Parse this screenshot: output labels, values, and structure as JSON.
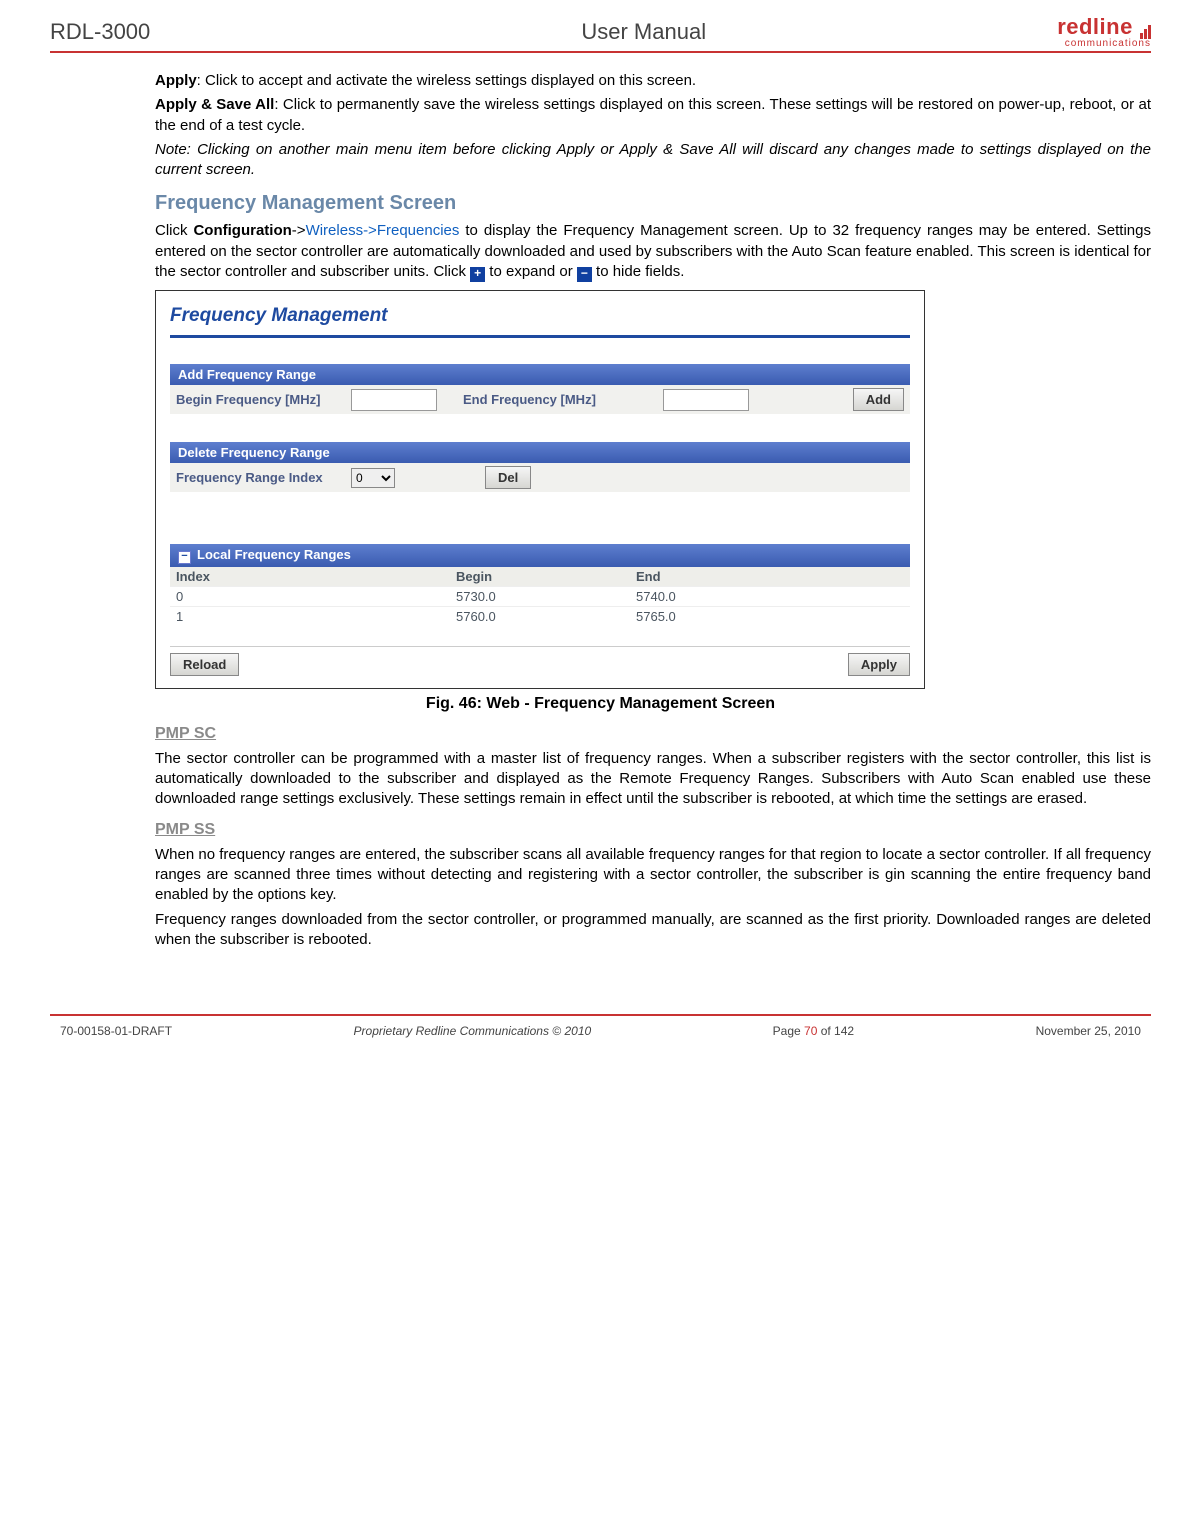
{
  "header": {
    "product": "RDL-3000",
    "doc_title": "User Manual",
    "logo_brand": "redline",
    "logo_sub": "communications"
  },
  "intro": {
    "apply_label": "Apply",
    "apply_text": ": Click to accept and activate the wireless settings displayed on this screen.",
    "applysave_label": "Apply & Save All",
    "applysave_text": ": Click to permanently save the wireless settings displayed on this screen. These settings will be restored on power-up, reboot, or at the end of a test cycle.",
    "note": "Note: Clicking on another main menu item before clicking Apply or Apply & Save All will discard any changes made to settings displayed on the current screen."
  },
  "section": {
    "heading": "Frequency Management Screen",
    "p1a": "Click ",
    "p1_config": "Configuration",
    "p1b": "->",
    "p1_link": "Wireless->Frequencies",
    "p1c": " to display the Frequency Management screen. Up to 32 frequency ranges may be entered. Settings entered on the sector controller are automatically downloaded and used by subscribers with the Auto Scan feature enabled. This screen is identical for the sector controller and subscriber units. Click ",
    "p1d": " to expand or ",
    "p1e": " to hide fields."
  },
  "screenshot": {
    "title": "Frequency Management",
    "add_section": "Add Frequency Range",
    "begin_label": "Begin Frequency [MHz]",
    "end_label": "End Frequency [MHz]",
    "add_btn": "Add",
    "del_section": "Delete Frequency Range",
    "range_index_label": "Frequency Range Index",
    "range_index_value": "0",
    "del_btn": "Del",
    "local_section": "Local Frequency Ranges",
    "grid_headers": {
      "a": "Index",
      "b": "Begin",
      "c": "End"
    },
    "rows": [
      {
        "index": "0",
        "begin": "5730.0",
        "end": "5740.0"
      },
      {
        "index": "1",
        "begin": "5760.0",
        "end": "5765.0"
      }
    ],
    "reload_btn": "Reload",
    "apply_btn": "Apply"
  },
  "fig": {
    "num": "Fig. 46",
    "caption": ": Web - Frequency Management Screen"
  },
  "pmp_sc": {
    "heading": "PMP SC",
    "text": "The sector controller can be programmed with a master list of frequency ranges. When a subscriber registers with the sector controller, this list is automatically downloaded to the subscriber and displayed as the Remote Frequency Ranges. Subscribers with Auto Scan enabled use these downloaded range settings exclusively. These settings remain in effect until the subscriber is rebooted, at which time the settings are erased."
  },
  "pmp_ss": {
    "heading": "PMP SS",
    "text1": "When no frequency ranges are entered, the subscriber scans all available frequency ranges for that region to locate a sector controller. If all frequency ranges are scanned three times without detecting and registering with a sector controller, the subscriber is gin scanning the entire frequency band enabled by the options key.",
    "text2": "Frequency ranges downloaded from the sector controller, or programmed manually, are scanned as the first priority. Downloaded ranges are deleted when the subscriber is rebooted."
  },
  "footer": {
    "docnum": "70-00158-01-DRAFT",
    "copyright": "Proprietary Redline Communications © 2010",
    "page_pre": "Page ",
    "page_cur": "70",
    "page_post": " of 142",
    "date": "November 25, 2010"
  }
}
